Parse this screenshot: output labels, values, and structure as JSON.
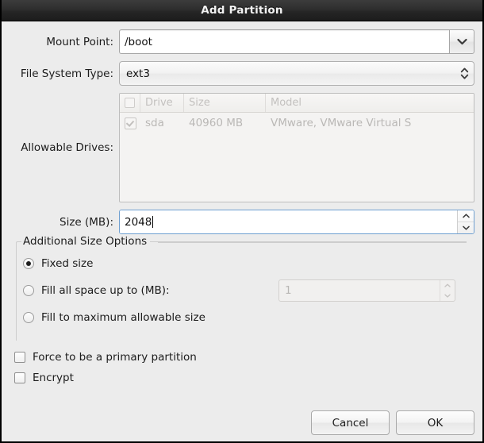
{
  "window": {
    "title": "Add Partition"
  },
  "form": {
    "mount_point": {
      "label": "Mount Point:",
      "value": "/boot",
      "icon": "chevron-down-icon"
    },
    "file_system_type": {
      "label": "File System Type:",
      "value": "ext3",
      "icon": "up-down-arrow-icon"
    },
    "allowable_drives": {
      "label": "Allowable Drives:",
      "columns": [
        "",
        "Drive",
        "Size",
        "Model"
      ],
      "rows": [
        {
          "checked": "checked",
          "drive": "sda",
          "size": "40960 MB",
          "model": "VMware, VMware Virtual S"
        }
      ]
    },
    "size_mb": {
      "label": "Size (MB):",
      "value": "2048"
    }
  },
  "additional_size_options": {
    "title": "Additional Size Options",
    "options": [
      {
        "label": "Fixed size",
        "selected": true
      },
      {
        "label": "Fill all space up to (MB):",
        "selected": false,
        "field_value": "1"
      },
      {
        "label": "Fill to maximum allowable size",
        "selected": false
      }
    ]
  },
  "checkboxes": [
    {
      "label": "Force to be a primary partition",
      "checked": false
    },
    {
      "label": "Encrypt",
      "checked": false
    }
  ],
  "buttons": {
    "cancel": "Cancel",
    "ok": "OK"
  },
  "colors": {
    "titlebar": "#2b2b2b",
    "dialog_bg": "#ececec",
    "focus_border": "#6f9fd0",
    "disabled_text": "#bab8b6"
  }
}
